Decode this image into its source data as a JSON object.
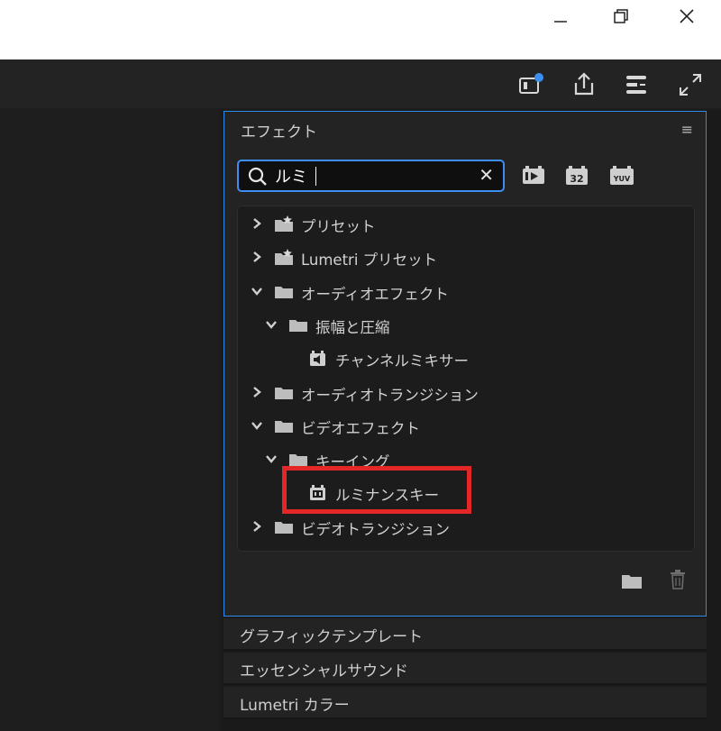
{
  "window_controls": {
    "minimize": "minimize-icon",
    "restore": "restore-icon",
    "close": "close-icon"
  },
  "toolbar": {
    "icons": [
      "quick-export-icon",
      "share-icon",
      "workspace-icon",
      "fullscreen-icon"
    ],
    "accent_color": "#2d8ceb"
  },
  "effects_panel": {
    "title": "エフェクト",
    "search": {
      "value": "ルミ",
      "placeholder": ""
    },
    "filter_buttons": [
      "accelerated-effects-icon",
      "32bit-icon",
      "yuv-icon"
    ],
    "filter_labels": {
      "accelerated": "",
      "bit32": "32",
      "yuv": "YUV"
    },
    "tree": [
      {
        "label": "プリセット",
        "depth": 0,
        "expanded": false,
        "type": "preset-folder"
      },
      {
        "label": "Lumetri プリセット",
        "depth": 0,
        "expanded": false,
        "type": "preset-folder"
      },
      {
        "label": "オーディオエフェクト",
        "depth": 0,
        "expanded": true,
        "type": "folder"
      },
      {
        "label": "振幅と圧縮",
        "depth": 1,
        "expanded": true,
        "type": "folder"
      },
      {
        "label": "チャンネルミキサー",
        "depth": 2,
        "type": "audio-effect"
      },
      {
        "label": "オーディオトランジション",
        "depth": 0,
        "expanded": false,
        "type": "folder"
      },
      {
        "label": "ビデオエフェクト",
        "depth": 0,
        "expanded": true,
        "type": "folder"
      },
      {
        "label": "キーイング",
        "depth": 1,
        "expanded": true,
        "type": "folder"
      },
      {
        "label": "ルミナンスキー",
        "depth": 2,
        "type": "video-effect",
        "highlighted": true
      },
      {
        "label": "ビデオトランジション",
        "depth": 0,
        "expanded": false,
        "type": "folder"
      }
    ],
    "highlight_color": "#e32727",
    "footer_icons": [
      "new-bin-icon",
      "trash-icon"
    ]
  },
  "collapsed_panels": [
    "グラフィックテンプレート",
    "エッセンシャルサウンド",
    "Lumetri カラー"
  ]
}
